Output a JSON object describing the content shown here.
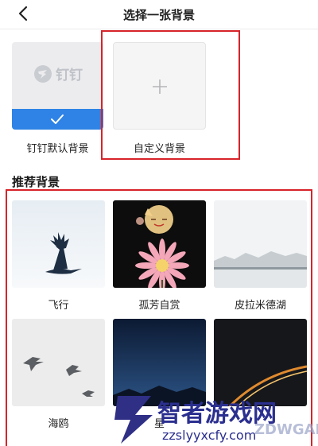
{
  "header": {
    "title": "选择一张背景"
  },
  "default_background": {
    "logo_text": "钉钉",
    "label": "钉钉默认背景",
    "selected": true
  },
  "custom_background": {
    "label": "自定义背景"
  },
  "recommended": {
    "title": "推荐背景",
    "items": [
      {
        "label": "飞行"
      },
      {
        "label": "孤芳自赏"
      },
      {
        "label": "皮拉米德湖"
      },
      {
        "label": "海鸥"
      },
      {
        "label": "星"
      },
      {
        "label": ""
      }
    ]
  },
  "colors": {
    "accent": "#2f83e6",
    "highlight": "#d7232a"
  },
  "watermark": {
    "title": "智者游戏网",
    "url": "zzslyyxcfy.com",
    "overlay": "ZDWGAME"
  }
}
